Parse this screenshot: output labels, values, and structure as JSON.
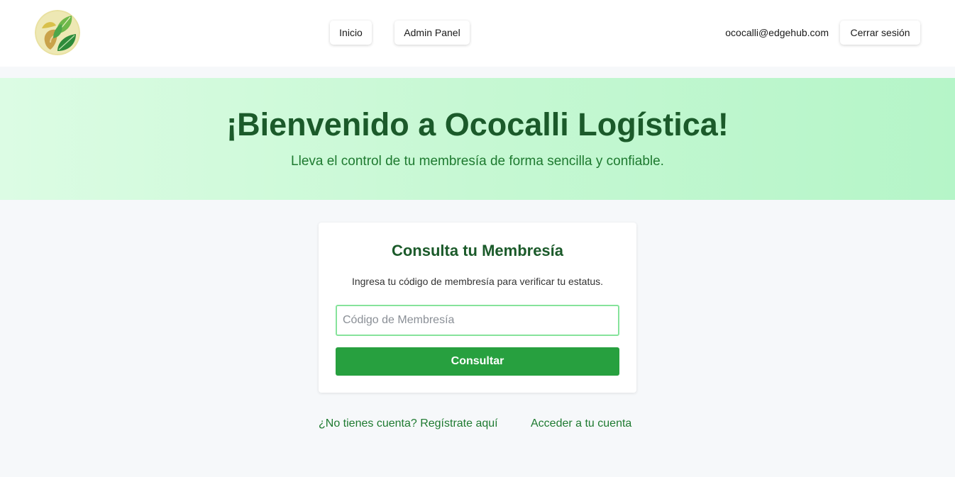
{
  "header": {
    "logo": {
      "name": "leaf-logo",
      "colors": {
        "background": "#e9e1a1",
        "leaf_dark": "#2e8b3a",
        "leaf_light": "#5cb85c",
        "gold": "#c9a24a"
      }
    },
    "nav": {
      "inicio_label": "Inicio",
      "admin_label": "Admin Panel"
    },
    "user_email": "ococalli@edgehub.com",
    "logout_label": "Cerrar sesión"
  },
  "hero": {
    "title": "¡Bienvenido a Ococalli Logística!",
    "subtitle": "Lleva el control de tu membresía de forma sencilla y confiable."
  },
  "membership_card": {
    "title": "Consulta tu Membresía",
    "description": "Ingresa tu código de membresía para verificar tu estatus.",
    "input_value": "",
    "input_placeholder": "Código de Membresía",
    "submit_label": "Consultar"
  },
  "links": {
    "register": "¿No tienes cuenta? Regístrate aquí",
    "login": "Acceder a tu cuenta"
  },
  "colors": {
    "primary_green": "#27a03f",
    "heading_green": "#1b5a2a",
    "link_green": "#1e7a30",
    "input_border": "#86e39b",
    "hero_gradient_start": "#dcfce4",
    "hero_gradient_end": "#b5f5c8",
    "page_background": "#f6f8fa"
  }
}
